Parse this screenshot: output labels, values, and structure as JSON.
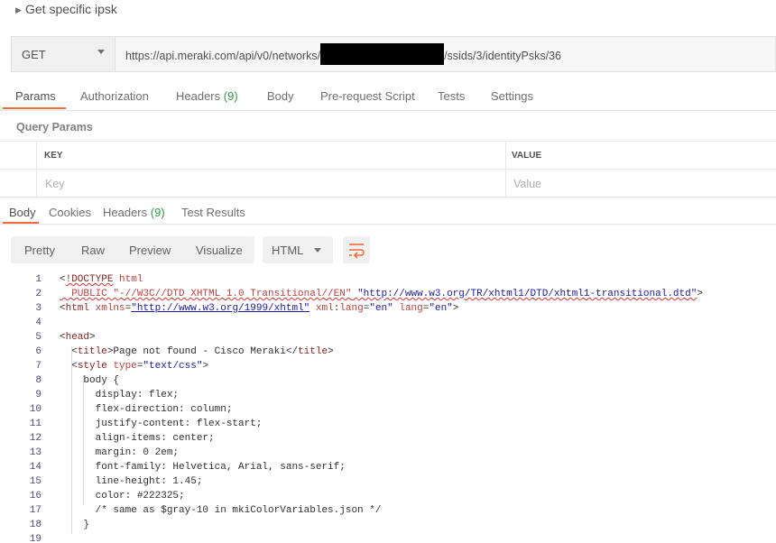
{
  "request": {
    "name": "Get specific ipsk",
    "method": "GET",
    "url_prefix": "https://api.meraki.com/api/v0/networks/",
    "url_suffix": "/ssids/3/identityPsks/36"
  },
  "request_tabs": [
    {
      "label": "Params",
      "count": ""
    },
    {
      "label": "Authorization",
      "count": ""
    },
    {
      "label": "Headers",
      "count": "(9)"
    },
    {
      "label": "Body",
      "count": ""
    },
    {
      "label": "Pre-request Script",
      "count": ""
    },
    {
      "label": "Tests",
      "count": ""
    },
    {
      "label": "Settings",
      "count": ""
    }
  ],
  "query_params": {
    "label": "Query Params",
    "key_header": "KEY",
    "value_header": "VALUE",
    "key_placeholder": "Key",
    "value_placeholder": "Value"
  },
  "response_tabs": [
    {
      "label": "Body",
      "count": ""
    },
    {
      "label": "Cookies",
      "count": ""
    },
    {
      "label": "Headers",
      "count": "(9)"
    },
    {
      "label": "Test Results",
      "count": ""
    }
  ],
  "view_buttons": [
    "Pretty",
    "Raw",
    "Preview",
    "Visualize"
  ],
  "format": "HTML",
  "colors": {
    "accent": "#f26b3a",
    "count": "#2b9b46"
  },
  "code_lines": [
    {
      "n": "1",
      "parts": [
        [
          "t-plain",
          "<"
        ],
        [
          "t-tag err",
          "!DOCTYPE"
        ],
        [
          "t-plain",
          " "
        ],
        [
          "t-attr",
          "html"
        ]
      ]
    },
    {
      "n": "2",
      "parts": [
        [
          "t-attr err",
          "  PUBLIC \"-//W3C//DTD XHTML 1.0 Transitional//EN\""
        ],
        [
          "t-plain err",
          " "
        ],
        [
          "t-str err",
          "\"http://www.w3.org/TR/xhtml1/DTD/xhtml1-transitional.dtd\""
        ],
        [
          "t-plain",
          ">"
        ]
      ]
    },
    {
      "n": "3",
      "parts": [
        [
          "t-plain",
          "<"
        ],
        [
          "t-tag",
          "html"
        ],
        [
          "t-plain",
          " "
        ],
        [
          "t-attr",
          "xmlns"
        ],
        [
          "t-plain",
          "="
        ],
        [
          "t-link",
          "\"http://www.w3.org/1999/xhtml\""
        ],
        [
          "t-plain",
          " "
        ],
        [
          "t-attr",
          "xml"
        ],
        [
          "t-plain",
          ":"
        ],
        [
          "t-attr",
          "lang"
        ],
        [
          "t-plain",
          "="
        ],
        [
          "t-str",
          "\"en\""
        ],
        [
          "t-plain",
          " "
        ],
        [
          "t-attr",
          "lang"
        ],
        [
          "t-plain",
          "="
        ],
        [
          "t-str",
          "\"en\""
        ],
        [
          "t-plain",
          ">"
        ]
      ]
    },
    {
      "n": "4",
      "parts": []
    },
    {
      "n": "5",
      "parts": [
        [
          "t-plain",
          "<"
        ],
        [
          "t-tag",
          "head"
        ],
        [
          "t-plain",
          ">"
        ]
      ]
    },
    {
      "n": "6",
      "parts": [
        [
          "t-plain",
          "  <"
        ],
        [
          "t-tag",
          "title"
        ],
        [
          "t-plain",
          ">Page not found - Cisco Meraki</"
        ],
        [
          "t-tag",
          "title"
        ],
        [
          "t-plain",
          ">"
        ]
      ]
    },
    {
      "n": "7",
      "parts": [
        [
          "t-plain",
          "  <"
        ],
        [
          "t-tag",
          "style"
        ],
        [
          "t-plain",
          " "
        ],
        [
          "t-attr",
          "type"
        ],
        [
          "t-plain",
          "="
        ],
        [
          "t-str",
          "\"text/css\""
        ],
        [
          "t-plain",
          ">"
        ]
      ]
    },
    {
      "n": "8",
      "parts": [
        [
          "t-plain",
          "    body {"
        ]
      ]
    },
    {
      "n": "9",
      "parts": [
        [
          "t-plain",
          "      display: flex;"
        ]
      ]
    },
    {
      "n": "10",
      "parts": [
        [
          "t-plain",
          "      flex-direction: column;"
        ]
      ]
    },
    {
      "n": "11",
      "parts": [
        [
          "t-plain",
          "      justify-content: flex-start;"
        ]
      ]
    },
    {
      "n": "12",
      "parts": [
        [
          "t-plain",
          "      align-items: center;"
        ]
      ]
    },
    {
      "n": "13",
      "parts": [
        [
          "t-plain",
          "      margin: 0 2em;"
        ]
      ]
    },
    {
      "n": "14",
      "parts": [
        [
          "t-plain",
          "      font-family: Helvetica, Arial, sans-serif;"
        ]
      ]
    },
    {
      "n": "15",
      "parts": [
        [
          "t-plain",
          "      line-height: 1.45;"
        ]
      ]
    },
    {
      "n": "16",
      "parts": [
        [
          "t-plain",
          "      color: #222325;"
        ]
      ]
    },
    {
      "n": "17",
      "parts": [
        [
          "t-plain",
          "      /* same as $gray-10 in mkiColorVariables.json */"
        ]
      ]
    },
    {
      "n": "18",
      "parts": [
        [
          "t-plain",
          "    }"
        ]
      ]
    },
    {
      "n": "19",
      "parts": []
    }
  ]
}
